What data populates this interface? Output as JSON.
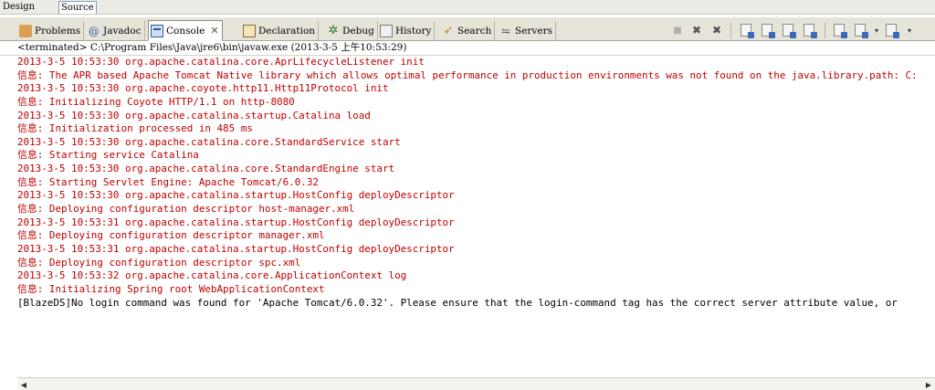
{
  "editor_tabs": {
    "design": "Design",
    "source": "Source"
  },
  "views": [
    {
      "label": "Problems",
      "icon": "problems-icon"
    },
    {
      "label": "Javadoc",
      "icon": "javadoc-icon"
    },
    {
      "label": "Console",
      "icon": "console-icon",
      "active": true
    },
    {
      "label": "Declaration",
      "icon": "declaration-icon"
    },
    {
      "label": "Debug",
      "icon": "debug-icon"
    },
    {
      "label": "History",
      "icon": "history-icon"
    },
    {
      "label": "Search",
      "icon": "search-icon"
    },
    {
      "label": "Servers",
      "icon": "servers-icon"
    }
  ],
  "glyphs": {
    "javadoc": "@",
    "debug": "✲",
    "search": "➶",
    "servers": "⇋",
    "close": "✕",
    "remove": "✖",
    "dropdown": "▾",
    "scroll_left": "◀",
    "scroll_right": "▶"
  },
  "toolbar": [
    "terminate-icon",
    "remove-launch-icon",
    "remove-all-terminated-icon",
    "clear-console-icon",
    "scroll-lock-icon",
    "word-wrap-icon",
    "show-console-on-output-icon",
    "pin-console-icon",
    "display-selected-console-icon",
    "open-console-icon"
  ],
  "status_line": "<terminated> C:\\Program Files\\Java\\jre6\\bin\\javaw.exe (2013-3-5 上午10:53:29)",
  "console_lines": [
    {
      "text": "2013-3-5 10:53:30 org.apache.catalina.core.AprLifecycleListener init",
      "kind": "err"
    },
    {
      "text": "信息: The APR based Apache Tomcat Native library which allows optimal performance in production environments was not found on the java.library.path: C:",
      "kind": "err"
    },
    {
      "text": "2013-3-5 10:53:30 org.apache.coyote.http11.Http11Protocol init",
      "kind": "err"
    },
    {
      "text": "信息: Initializing Coyote HTTP/1.1 on http-8080",
      "kind": "err"
    },
    {
      "text": "2013-3-5 10:53:30 org.apache.catalina.startup.Catalina load",
      "kind": "err"
    },
    {
      "text": "信息: Initialization processed in 485 ms",
      "kind": "err"
    },
    {
      "text": "2013-3-5 10:53:30 org.apache.catalina.core.StandardService start",
      "kind": "err"
    },
    {
      "text": "信息: Starting service Catalina",
      "kind": "err"
    },
    {
      "text": "2013-3-5 10:53:30 org.apache.catalina.core.StandardEngine start",
      "kind": "err"
    },
    {
      "text": "信息: Starting Servlet Engine: Apache Tomcat/6.0.32",
      "kind": "err"
    },
    {
      "text": "2013-3-5 10:53:30 org.apache.catalina.startup.HostConfig deployDescriptor",
      "kind": "err"
    },
    {
      "text": "信息: Deploying configuration descriptor host-manager.xml",
      "kind": "err"
    },
    {
      "text": "2013-3-5 10:53:31 org.apache.catalina.startup.HostConfig deployDescriptor",
      "kind": "err"
    },
    {
      "text": "信息: Deploying configuration descriptor manager.xml",
      "kind": "err"
    },
    {
      "text": "2013-3-5 10:53:31 org.apache.catalina.startup.HostConfig deployDescriptor",
      "kind": "err"
    },
    {
      "text": "信息: Deploying configuration descriptor spc.xml",
      "kind": "err"
    },
    {
      "text": "2013-3-5 10:53:32 org.apache.catalina.core.ApplicationContext log",
      "kind": "err"
    },
    {
      "text": "信息: Initializing Spring root WebApplicationContext",
      "kind": "err"
    },
    {
      "text": "[BlazeDS]No login command was found for 'Apache Tomcat/6.0.32'. Please ensure that the login-command tag has the correct server attribute value, or",
      "kind": "out"
    }
  ]
}
